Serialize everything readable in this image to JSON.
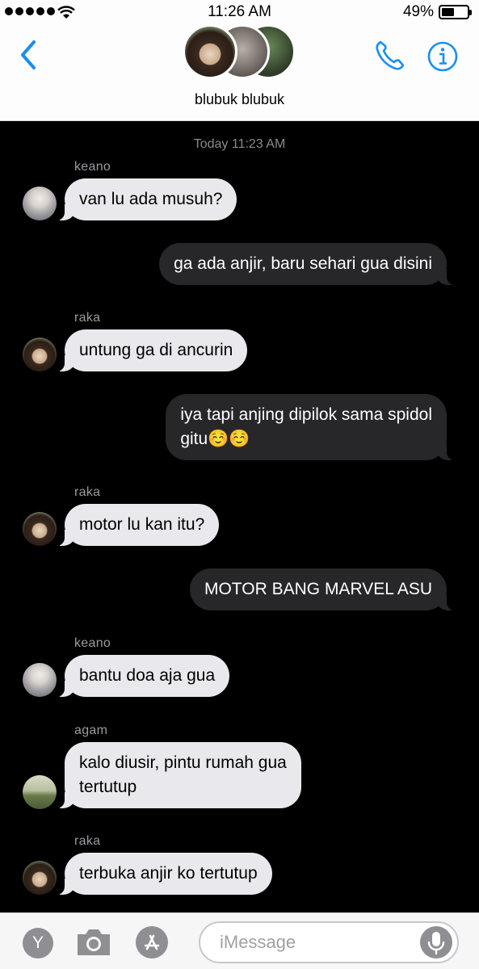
{
  "status_bar": {
    "time": "11:26 AM",
    "battery_percent": "49%",
    "battery_level": 0.49
  },
  "header": {
    "group_name": "blubuk blubuk",
    "back_icon": "chevron-left-icon",
    "call_icon": "phone-icon",
    "info_icon": "info-icon",
    "accent_color": "#1b8ef0"
  },
  "chat": {
    "timestamp": "Today 11:23 AM",
    "messages": [
      {
        "direction": "in",
        "sender": "keano",
        "text": "van lu ada musuh?"
      },
      {
        "direction": "out",
        "text": "ga ada anjir, baru sehari gua disini"
      },
      {
        "direction": "in",
        "sender": "raka",
        "text": "untung ga di ancurin"
      },
      {
        "direction": "out",
        "text": "iya tapi anjing dipilok sama spidol\ngitu☺️☺️"
      },
      {
        "direction": "in",
        "sender": "raka",
        "text": "motor lu kan itu?"
      },
      {
        "direction": "out",
        "text": "MOTOR BANG MARVEL ASU"
      },
      {
        "direction": "in",
        "sender": "keano",
        "text": "bantu doa aja gua"
      },
      {
        "direction": "in",
        "sender": "agam",
        "text": "kalo diusir, pintu rumah gua\ntertutup"
      },
      {
        "direction": "in",
        "sender": "raka",
        "text": "terbuka anjir ko tertutup"
      }
    ]
  },
  "input_bar": {
    "placeholder": "iMessage",
    "app_button_label": "Y"
  }
}
